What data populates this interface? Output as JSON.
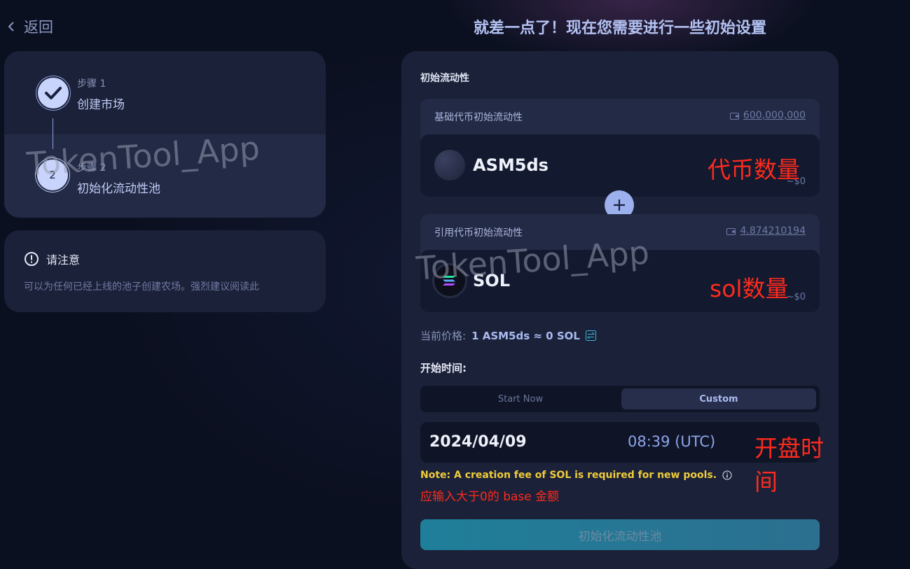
{
  "back": {
    "label": "返回"
  },
  "headline": "就差一点了！现在您需要进行一些初始设置",
  "steps": [
    {
      "label": "步骤 1",
      "title": "创建市场",
      "status": "done"
    },
    {
      "label": "步骤 2",
      "title": "初始化流动性池",
      "number": "2",
      "status": "current"
    }
  ],
  "notice": {
    "title": "请注意",
    "text": "可以为任何已经上线的池子创建农场。强烈建议阅读此"
  },
  "panel": {
    "section_title": "初始流动性",
    "base": {
      "label": "基础代币初始流动性",
      "balance": "600,000,000",
      "token": "ASM5ds",
      "usd": "~$0"
    },
    "quote": {
      "label": "引用代币初始流动性",
      "balance": "4.874210194",
      "token": "SOL",
      "usd": "~$0"
    },
    "price": {
      "label": "当前价格:",
      "value": "1 ASM5ds ≈ 0 SOL"
    },
    "start_time_label": "开始时间:",
    "start_options": {
      "now": "Start Now",
      "custom": "Custom",
      "selected": "custom"
    },
    "date": "2024/04/09",
    "time": "08:39 (UTC)",
    "fee_note": "Note: A creation fee of  SOL is required for new pools.",
    "error": "应输入大于0的 base 金额",
    "submit": "初始化流动性池"
  },
  "annotations": {
    "token_amount": "代币数量",
    "sol_amount": "sol数量",
    "open_time": "开盘时间"
  },
  "watermark": "TokenTool_App",
  "colors": {
    "background": "#0b1020",
    "card": "#1b2138",
    "accent": "#9db0ee",
    "warning": "#f0cd3a",
    "annotation": "#ff2a1c"
  }
}
